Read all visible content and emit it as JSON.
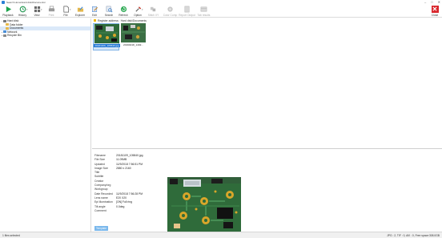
{
  "window": {
    "title": "Search Home\\Hard disk\\Documents\\",
    "controls": [
      "–",
      "□",
      "✕"
    ]
  },
  "toolbar": {
    "items": [
      {
        "label": "Playback",
        "icon": "play-icon",
        "color": "#1aa34a",
        "enabled": true
      },
      {
        "label": "History",
        "icon": "history-icon",
        "color": "#2d9d59",
        "enabled": true
      },
      {
        "label": "View",
        "icon": "view-icon",
        "color": "#6a6a6a",
        "enabled": true
      },
      {
        "label": "Print",
        "icon": "print-icon",
        "color": "#9a9a9a",
        "enabled": false
      },
      {
        "label": "File",
        "icon": "file-icon",
        "color": "#5b5b5b",
        "enabled": true
      },
      {
        "label": "Explorer",
        "icon": "explorer-icon",
        "color": "#3a86d6",
        "enabled": true
      },
      {
        "label": "Edit",
        "icon": "edit-icon",
        "color": "#5a8fd0",
        "enabled": true
      },
      {
        "label": "Search",
        "icon": "search-icon",
        "color": "#3c7fc7",
        "enabled": true
      },
      {
        "label": "Refresh",
        "icon": "refresh-icon",
        "color": "#2eaa55",
        "enabled": true
      },
      {
        "label": "Option",
        "icon": "option-icon",
        "color": "#c23a2c",
        "enabled": true
      },
      {
        "label": "Stitch XY",
        "icon": "stitch-icon",
        "color": "#b5b5b5",
        "enabled": false
      },
      {
        "label": "Color Comp",
        "icon": "color-comp-icon",
        "color": "#b5b5b5",
        "enabled": false
      },
      {
        "label": "Report Output",
        "icon": "report-icon",
        "color": "#b5b5b5",
        "enabled": false
      },
      {
        "label": "Tab results",
        "icon": "tab-results-icon",
        "color": "#b5b5b5",
        "enabled": false
      }
    ],
    "close_label": "Close"
  },
  "tree": [
    {
      "label": "Hard disk",
      "level": 0,
      "expander": "−",
      "color": "#777777",
      "selected": false
    },
    {
      "label": "Data folder",
      "level": 1,
      "expander": "",
      "color": "#e6b84a",
      "selected": false
    },
    {
      "label": "Documents",
      "level": 1,
      "expander": "",
      "color": "#e6b84a",
      "selected": true
    },
    {
      "label": "Network",
      "level": 0,
      "expander": "+",
      "color": "#4b8fd8",
      "selected": false
    },
    {
      "label": "Recycle Bin",
      "level": 0,
      "expander": "+",
      "color": "#8a8a8a",
      "selected": false
    }
  ],
  "address": {
    "label": "Register address:",
    "path": "Hard disk\\Documents"
  },
  "thumbnails": [
    {
      "caption": "20181109_105840.jpg",
      "selected": true
    },
    {
      "caption": "20190218_1402...",
      "selected": false
    }
  ],
  "properties": [
    {
      "key": "Filename",
      "value": "20181109_105840.jpg"
    },
    {
      "key": "File Size",
      "value": "11.09MB"
    },
    {
      "key": "Updated",
      "value": "11/9/2018 7:56:51 PM"
    },
    {
      "key": "Image Size",
      "value": "2880 x 2160"
    },
    {
      "key": "Title",
      "value": ""
    },
    {
      "key": "Subtitle",
      "value": ""
    },
    {
      "key": "Creator",
      "value": ""
    },
    {
      "key": "Company/org",
      "value": ""
    },
    {
      "key": "Workgroup",
      "value": ""
    },
    {
      "key": "Date Recorded",
      "value": "11/9/2018 7:56:28 PM"
    },
    {
      "key": "Lens name",
      "value": "E20 X20"
    },
    {
      "key": "Epi illumination",
      "value": "[ON] Full ring"
    },
    {
      "key": "Tilt angle",
      "value": "0.0deg"
    },
    {
      "key": "Comment",
      "value": ""
    }
  ],
  "template_button": "Template",
  "status": {
    "left": "1 files selected",
    "right": "JPG : 2, TIF : 0, AVI : 0, Free space:308.0GB"
  },
  "colors": {
    "selection": "#1e74d2",
    "board_green": "#2f6b3a",
    "pad_gold": "#d9a62a",
    "close_red": "#d9262c"
  }
}
